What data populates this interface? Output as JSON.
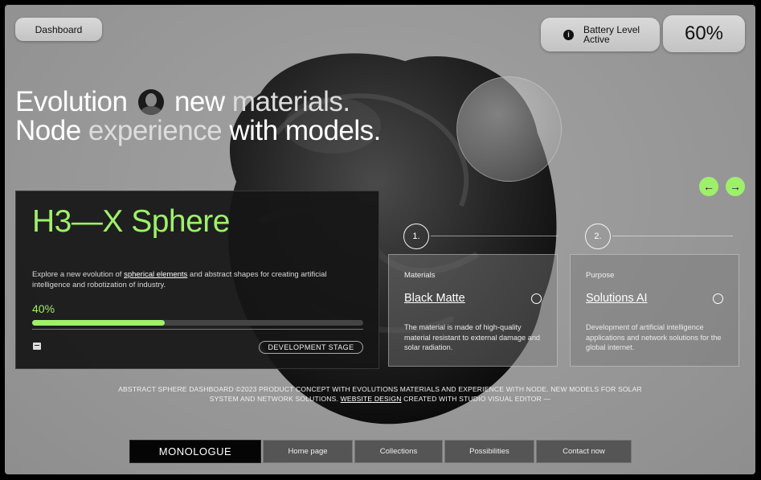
{
  "header": {
    "dashboard_label": "Dashboard",
    "battery_label_line1": "Battery Level",
    "battery_label_line2": "Active",
    "battery_value": "60%",
    "info_icon_glyph": "i"
  },
  "hero": {
    "w1": "Evolution",
    "w2": "new",
    "w3": "materials.",
    "w4": "Node",
    "w5": "experience",
    "w6": "with models."
  },
  "product_card": {
    "title": "H3—X Sphere",
    "desc_before": "Explore a new evolution of ",
    "desc_link": "spherical elements",
    "desc_after": " and abstract shapes for creating artificial intelligence and robotization of industry.",
    "progress_label": "40%",
    "progress_value": 0.4,
    "stage_label": "DEVELOPMENT STAGE"
  },
  "carousel": {
    "prev_glyph": "←",
    "next_glyph": "→"
  },
  "features": [
    {
      "step": "1.",
      "kicker": "Materials",
      "title": "Black Matte",
      "body": "The material is made of high-quality material resistant to external damage and solar radiation."
    },
    {
      "step": "2.",
      "kicker": "Purpose",
      "title": "Solutions AI",
      "body": "Development of artificial intelligence applications and network solutions for the global internet."
    }
  ],
  "footer": {
    "line1": "ABSTRACT SPHERE DASHBOARD ©2023 PRODUCT CONCEPT WITH EVOLUTIONS MATERIALS AND EXPERIENCE WITH NODE. NEW MODELS FOR SOLAR",
    "line2_before": "SYSTEM AND NETWORK SOLUTIONS. ",
    "line2_link": "WEBSITE DESIGN",
    "line2_after": " CREATED WITH STUDIO VISUAL EDITOR —"
  },
  "nav": {
    "brand": "MONOLOGUE",
    "items": [
      "Home page",
      "Collections",
      "Possibilities",
      "Contact now"
    ]
  },
  "colors": {
    "accent": "#9ef06b",
    "card_bg": "#161616",
    "background": "#9a9a9a"
  }
}
